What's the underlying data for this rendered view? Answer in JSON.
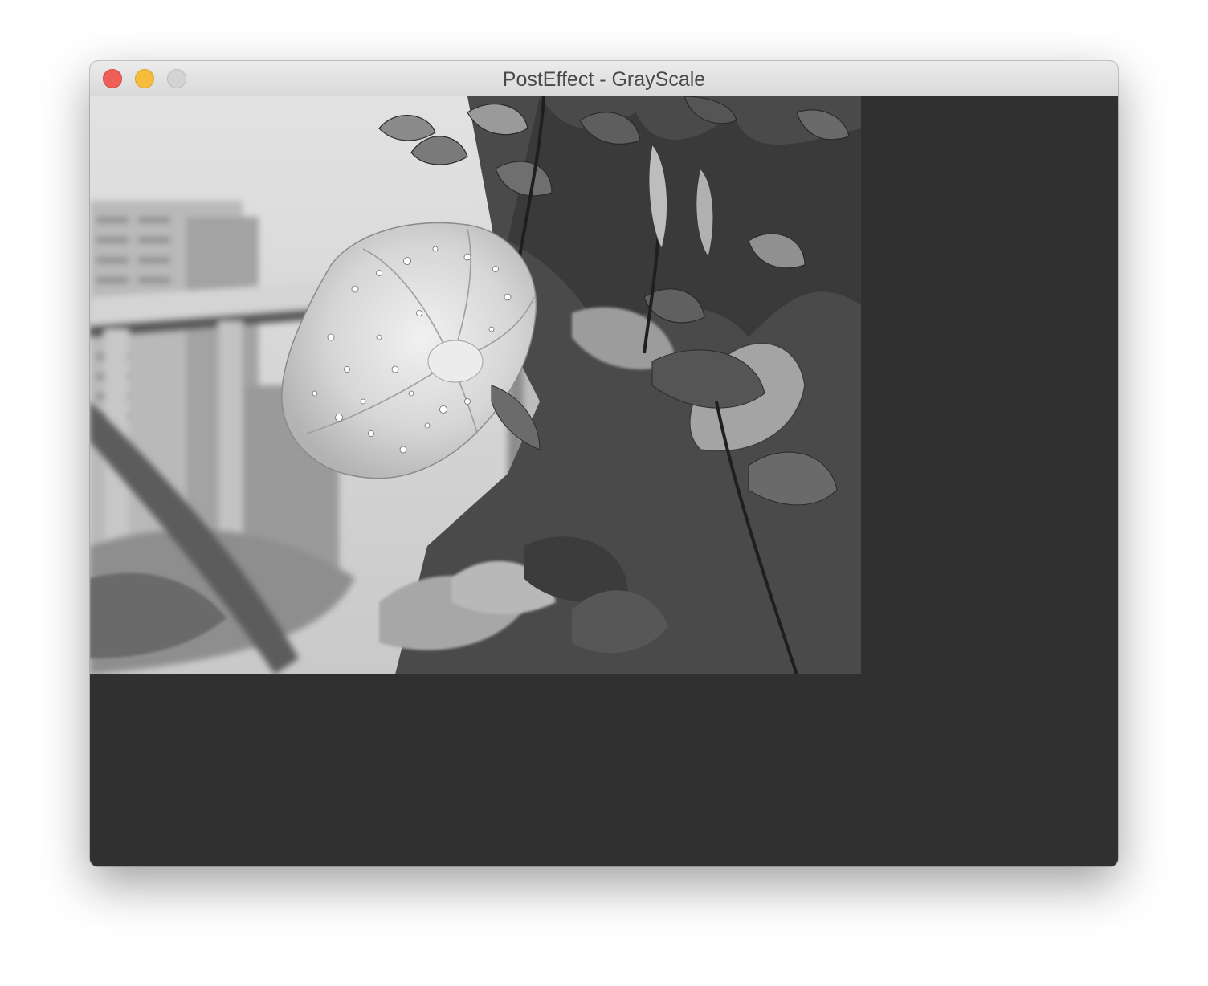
{
  "window": {
    "title": "PostEffect - GrayScale"
  },
  "controls": {
    "close_icon": "close-icon",
    "minimize_icon": "minimize-icon",
    "zoom_icon": "zoom-icon"
  },
  "colors": {
    "content_background": "#303030",
    "close": "#ee5f57",
    "minimize": "#f6bd3d",
    "zoom_disabled": "#d3d3d3"
  },
  "canvas": {
    "effect": "grayscale",
    "subject": "morning glory flower with raindrops among leaves"
  }
}
